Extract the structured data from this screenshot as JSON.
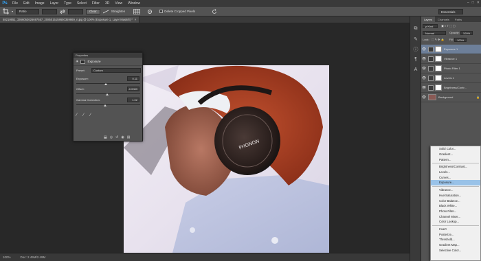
{
  "menubar": {
    "logo": "Ps",
    "items": [
      "File",
      "Edit",
      "Image",
      "Layer",
      "Type",
      "Select",
      "Filter",
      "3D",
      "View",
      "Window"
    ],
    "window_controls": [
      "–",
      "□",
      "✕"
    ]
  },
  "options_bar": {
    "ratio_select": "Ratio",
    "clear_button": "Clear",
    "straighten_label": "Straighten",
    "delete_cropped_label": "Delete Cropped Pixels",
    "workspace": "Essentials"
  },
  "tab": {
    "title": "58218651_3366053626697557_2085015158650359869_n.jpg @ 100% (Exposure 1, Layer Mask/8) *"
  },
  "properties": {
    "panel_title": "Properties",
    "header": "Exposure",
    "preset_label": "Preset:",
    "preset_value": "Custom",
    "exposure_label": "Exposure:",
    "exposure_value": "0.11",
    "offset_label": "Offset:",
    "offset_value": "-0.0083",
    "gamma_label": "Gamma Correction:",
    "gamma_value": "1.02"
  },
  "status_bar": {
    "zoom": "100%",
    "doc": "Doc: 2.49M/2.49M"
  },
  "layers_panel": {
    "tabs": [
      "Layers",
      "Channels",
      "Paths"
    ],
    "kind_label": "ρ Kind",
    "blend_mode": "Normal",
    "opacity_label": "Opacity:",
    "opacity_value": "100%",
    "lock_label": "Lock:",
    "fill_label": "Fill:",
    "fill_value": "100%",
    "layers": [
      {
        "name": "Exposure 1",
        "type": "adjustment",
        "selected": true
      },
      {
        "name": "Vibrance 1",
        "type": "adjustment",
        "selected": false
      },
      {
        "name": "Photo Filter 1",
        "type": "adjustment",
        "selected": false
      },
      {
        "name": "Levels 1",
        "type": "adjustment",
        "selected": false
      },
      {
        "name": "Brightness/Contr...",
        "type": "adjustment",
        "selected": false
      },
      {
        "name": "Background",
        "type": "image",
        "selected": false
      }
    ]
  },
  "adjustment_menu": {
    "groups": [
      [
        "Solid Color...",
        "Gradient...",
        "Pattern..."
      ],
      [
        "Brightness/Contrast...",
        "Levels...",
        "Curves...",
        "Exposure..."
      ],
      [
        "Vibrance...",
        "Hue/Saturation...",
        "Color Balance...",
        "Black  White...",
        "Photo Filter...",
        "Channel Mixer...",
        "Color Lookup..."
      ],
      [
        "Invert",
        "Posterize...",
        "Threshold...",
        "Gradient Map...",
        "Selective Color..."
      ]
    ],
    "highlighted": "Exposure..."
  },
  "photo": {
    "brand_text": "PHONON"
  },
  "colors": {
    "selection_blue": "#6d7f99",
    "menu_highlight": "#99c2e8",
    "ps_blue": "#31a8ff"
  }
}
